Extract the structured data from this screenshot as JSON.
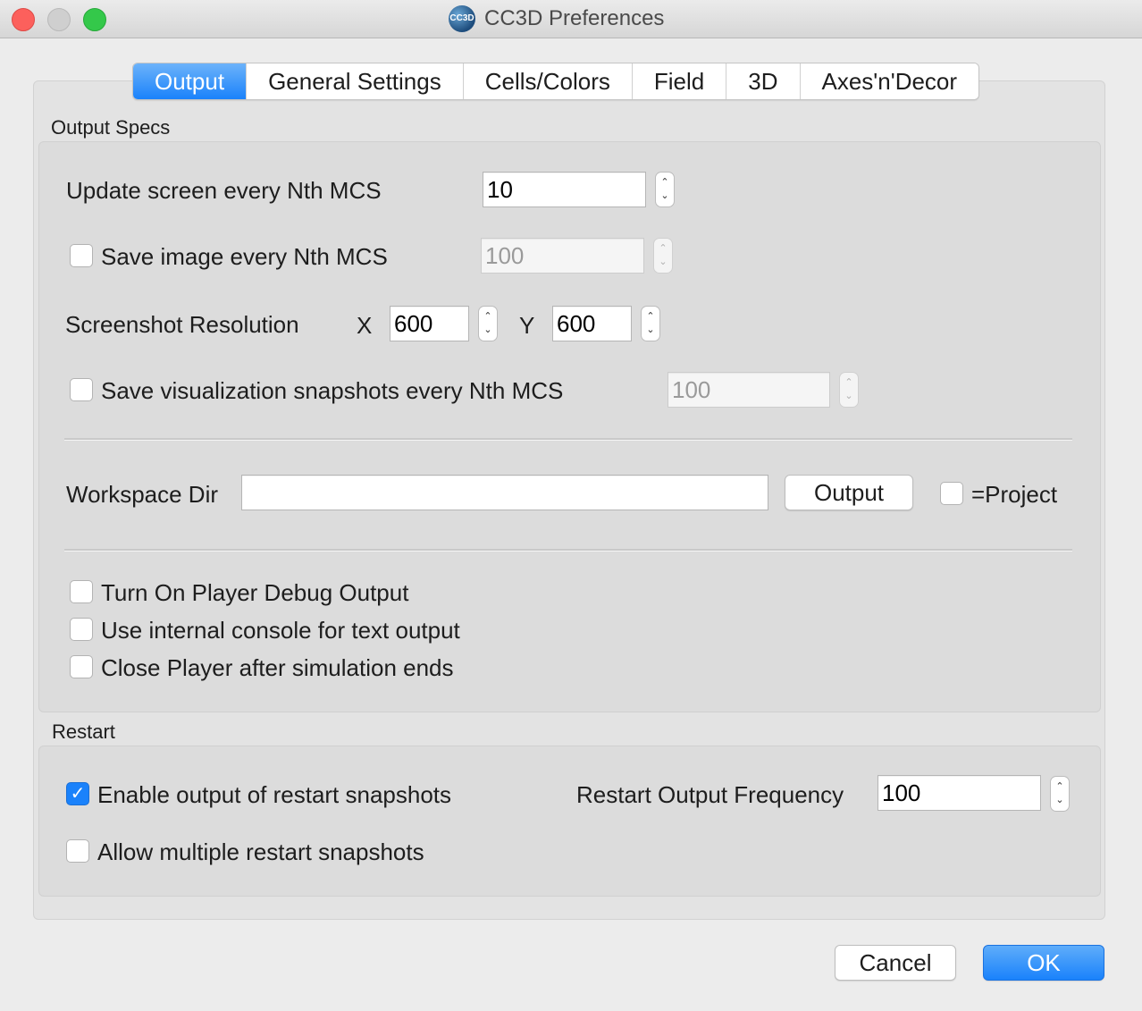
{
  "window": {
    "title": "CC3D Preferences",
    "logo_text": "CC3D"
  },
  "tabs": [
    "Output",
    "General Settings",
    "Cells/Colors",
    "Field",
    "3D",
    "Axes'n'Decor"
  ],
  "output_specs": {
    "title": "Output Specs",
    "update_screen_label": "Update screen every Nth MCS",
    "update_screen_value": "10",
    "save_image_label": "Save image every Nth MCS",
    "save_image_value": "100",
    "save_image_checked": false,
    "screenshot_res_label": "Screenshot Resolution",
    "x_label": "X",
    "x_value": "600",
    "y_label": "Y",
    "y_value": "600",
    "save_snapshots_label": "Save visualization snapshots every Nth MCS",
    "save_snapshots_value": "100",
    "save_snapshots_checked": false,
    "workspace_dir_label": "Workspace Dir",
    "workspace_dir_value": "",
    "output_button_label": "Output",
    "project_label": "=Project",
    "project_checked": false,
    "debug_output_label": "Turn On Player Debug Output",
    "internal_console_label": "Use internal console for text output",
    "close_player_label": "Close Player after simulation ends"
  },
  "restart": {
    "title": "Restart",
    "enable_label": "Enable output of restart snapshots",
    "enable_checked": true,
    "frequency_label": "Restart Output Frequency",
    "frequency_value": "100",
    "allow_multiple_label": "Allow multiple restart snapshots",
    "allow_multiple_checked": false
  },
  "footer": {
    "cancel_label": "Cancel",
    "ok_label": "OK"
  },
  "colors": {
    "accent": "#1a82fb",
    "window_bg": "#ececec",
    "group_bg": "#dcdcdc"
  }
}
